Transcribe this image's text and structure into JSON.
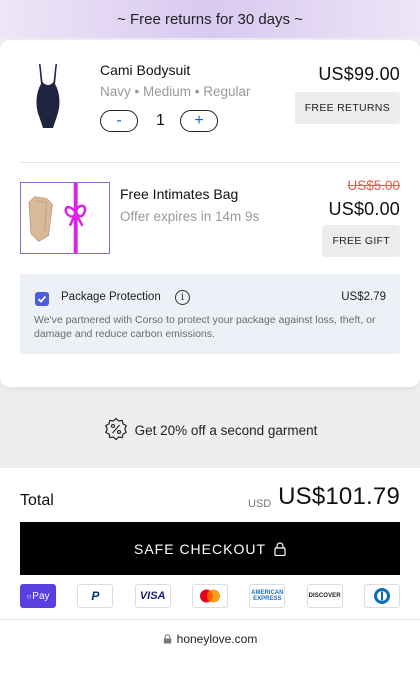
{
  "promo": {
    "text": "~ Free returns for 30 days ~"
  },
  "items": [
    {
      "name": "Cami Bodysuit",
      "meta": "Navy • Medium • Regular",
      "qty_minus": "-",
      "qty": "1",
      "qty_plus": "+",
      "price": "US$99.00",
      "tag": "FREE RETURNS",
      "icon": "bodysuit-thumbnail",
      "color": "#1f2340"
    },
    {
      "name": "Free Intimates Bag",
      "meta": "Offer expires in 14m 9s",
      "original_price": "US$5.00",
      "price": "US$0.00",
      "tag": "FREE GIFT",
      "icon": "gift-bag-thumbnail",
      "ribbon_color": "#e01ee8"
    }
  ],
  "protection": {
    "title": "Package Protection",
    "price": "US$2.79",
    "checked": true,
    "description": "We've partnered with Corso to protect your package against loss, theft, or damage and reduce carbon emissions."
  },
  "offer": {
    "text": "Get 20% off a second garment",
    "icon": "percent-badge-icon"
  },
  "checkout": {
    "total_label": "Total",
    "currency": "USD",
    "total": "US$101.79",
    "button_label": "SAFE CHECKOUT",
    "button_icon": "lock-icon"
  },
  "payments": [
    {
      "name": "opay",
      "label": "Pay",
      "color": "#5a3ee0"
    },
    {
      "name": "paypal",
      "label": "P"
    },
    {
      "name": "visa",
      "label": "VISA"
    },
    {
      "name": "mastercard",
      "label": ""
    },
    {
      "name": "amex",
      "label": "AMERICAN EXPRESS"
    },
    {
      "name": "discover",
      "label": "DISCOVER"
    },
    {
      "name": "diners",
      "label": ""
    }
  ],
  "footer": {
    "domain": "honeylove.com"
  }
}
